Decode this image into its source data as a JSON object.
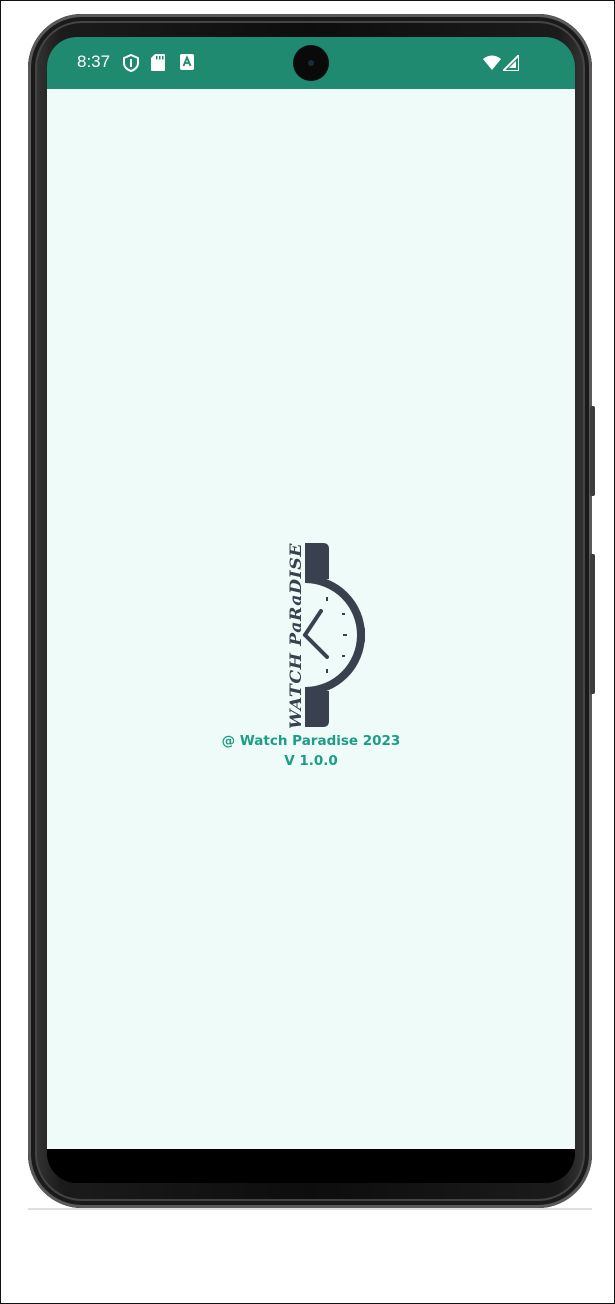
{
  "status_bar": {
    "time": "8:37",
    "background_color": "#1f8a70",
    "icons_left": [
      "shield-icon",
      "sd-card-icon",
      "keyboard-a-icon"
    ],
    "icons_right": [
      "wifi-icon",
      "cell-signal-icon"
    ]
  },
  "splash": {
    "background_color": "#effbf8",
    "logo_text": "WATCH PaRaDISE",
    "copyright": "@ Watch Paradise 2023",
    "version": "V 1.0.0",
    "text_color": "#1d9c86",
    "logo_color": "#39414f"
  }
}
